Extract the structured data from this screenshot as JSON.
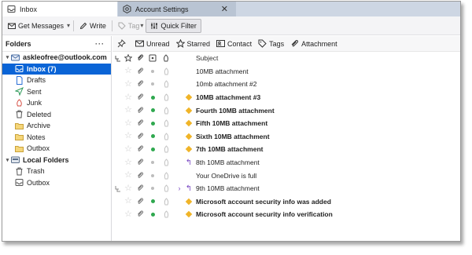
{
  "tabs": [
    {
      "label": "Inbox",
      "icon": "inbox-icon"
    },
    {
      "label": "Account Settings",
      "icon": "gear-icon"
    }
  ],
  "toolbar": {
    "get_messages": "Get Messages",
    "write": "Write",
    "tag": "Tag",
    "quick_filter": "Quick Filter"
  },
  "folders": {
    "header": "Folders",
    "menu": "···",
    "accounts": [
      {
        "name": "askleofree@outlook.com",
        "items": [
          {
            "label": "Inbox (7)",
            "icon": "inbox-icon",
            "selected": true
          },
          {
            "label": "Drafts",
            "icon": "drafts-icon"
          },
          {
            "label": "Sent",
            "icon": "sent-icon"
          },
          {
            "label": "Junk",
            "icon": "junk-icon"
          },
          {
            "label": "Deleted",
            "icon": "trash-icon"
          },
          {
            "label": "Archive",
            "icon": "archive-icon"
          },
          {
            "label": "Notes",
            "icon": "folder-icon"
          },
          {
            "label": "Outbox",
            "icon": "folder-icon"
          }
        ]
      },
      {
        "name": "Local Folders",
        "items": [
          {
            "label": "Trash",
            "icon": "trash-icon"
          },
          {
            "label": "Outbox",
            "icon": "outbox-icon"
          }
        ]
      }
    ]
  },
  "filters": {
    "unread": "Unread",
    "starred": "Starred",
    "contact": "Contact",
    "tags": "Tags",
    "attachment": "Attachment"
  },
  "columns": {
    "subject": "Subject"
  },
  "messages": [
    {
      "subject": "10MB attachment",
      "unread": false,
      "green": false,
      "tag": false,
      "reply": false
    },
    {
      "subject": "10mb attachment #2",
      "unread": false,
      "green": false,
      "tag": false,
      "reply": false
    },
    {
      "subject": "10MB attachment #3",
      "unread": true,
      "green": true,
      "tag": true,
      "reply": false
    },
    {
      "subject": "Fourth 10MB attachment",
      "unread": true,
      "green": true,
      "tag": true,
      "reply": false
    },
    {
      "subject": "Fifth 10MB attachment",
      "unread": true,
      "green": true,
      "tag": true,
      "reply": false
    },
    {
      "subject": "Sixth 10MB attachment",
      "unread": true,
      "green": true,
      "tag": true,
      "reply": false
    },
    {
      "subject": "7th 10MB attachment",
      "unread": true,
      "green": true,
      "tag": true,
      "reply": false
    },
    {
      "subject": "8th 10MB attachment",
      "unread": false,
      "green": false,
      "tag": false,
      "reply": true
    },
    {
      "subject": "Your OneDrive is full",
      "unread": false,
      "green": false,
      "tag": false,
      "reply": false
    },
    {
      "subject": "9th 10MB attachment",
      "unread": false,
      "green": false,
      "tag": false,
      "reply": true,
      "thread": true
    },
    {
      "subject": "Microsoft account security info was added",
      "unread": true,
      "green": true,
      "tag": true,
      "reply": false
    },
    {
      "subject": "Microsoft account security info verification",
      "unread": true,
      "green": true,
      "tag": true,
      "reply": false
    }
  ],
  "colors": {
    "selected": "#0a64d6",
    "green_dot": "#2fa84f",
    "tag": "#f0b428",
    "tabbar": "#cdd6e3"
  }
}
